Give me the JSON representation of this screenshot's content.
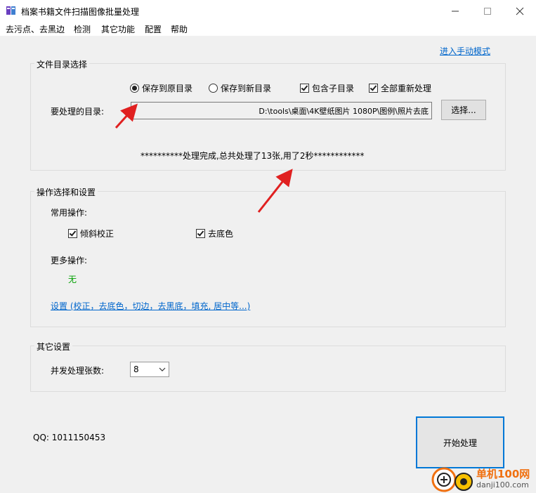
{
  "window": {
    "title": "档案书籍文件扫描图像批量处理"
  },
  "menu": [
    "去污点、去黑边",
    "检测",
    "其它功能",
    "配置",
    "帮助"
  ],
  "manual_mode_link": "进入手动模式",
  "dir_group": {
    "legend": "文件目录选择",
    "save_original": "保存到原目录",
    "save_new": "保存到新目录",
    "include_sub": "包含子目录",
    "reprocess_all": "全部重新处理",
    "dir_label": "要处理的目录:",
    "dir_path": "D:\\tools\\桌面\\4K壁纸图片 1080P\\图例\\照片去底",
    "choose_button": "选择...",
    "status": "**********处理完成,总共处理了13张,用了2秒************"
  },
  "ops_group": {
    "legend": "操作选择和设置",
    "common_label": "常用操作:",
    "deskew": "倾斜校正",
    "remove_bg": "去底色",
    "more_label": "更多操作:",
    "more_value": "无",
    "settings_link": "设置 (校正，去底色，切边，去黑底，填充, 居中等...)"
  },
  "other_group": {
    "legend": "其它设置",
    "concurrency_label": "并发处理张数:",
    "concurrency_value": "8"
  },
  "qq": "QQ: 1011150453",
  "start_button": "开始处理",
  "watermark": {
    "cn": "单机100网",
    "url": "danji100.com"
  },
  "colors": {
    "accent": "#0078d7",
    "link": "#0066cc",
    "arrow": "#e02020",
    "green": "#00a000"
  }
}
